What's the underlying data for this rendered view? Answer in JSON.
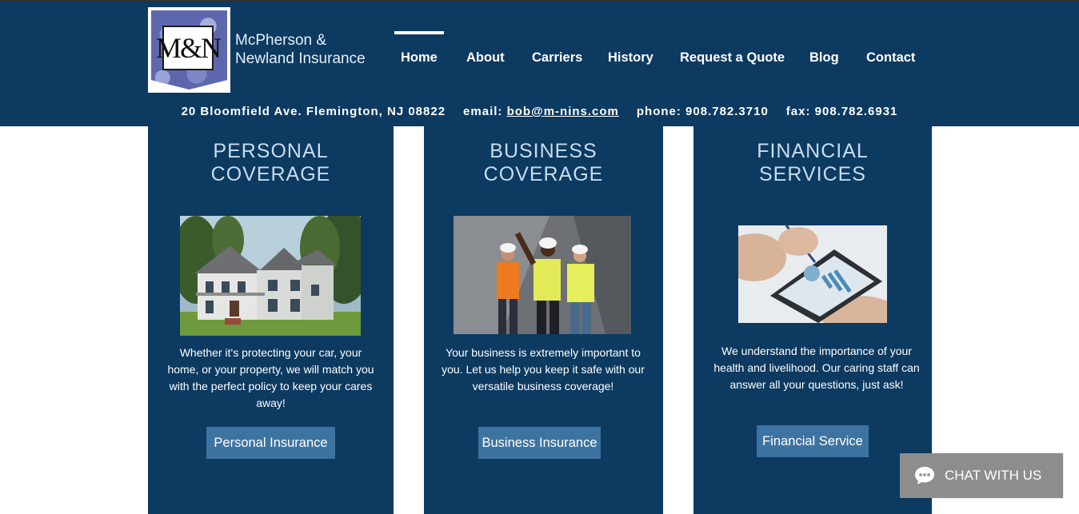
{
  "brand": {
    "logo_text": "M&N",
    "name_line1": "McPherson &",
    "name_line2": "Newland Insurance"
  },
  "nav": {
    "items": [
      {
        "label": "Home",
        "active": true
      },
      {
        "label": "About"
      },
      {
        "label": "Carriers"
      },
      {
        "label": "History"
      },
      {
        "label": "Request a Quote"
      },
      {
        "label": "Blog"
      },
      {
        "label": "Contact"
      }
    ]
  },
  "contact": {
    "address": "20 Bloomfield Ave. Flemington, NJ 08822",
    "email_label": "email:",
    "email": "bob@m-nins.com",
    "phone": "phone: 908.782.3710",
    "fax": "fax: 908.782.6931"
  },
  "cards": [
    {
      "title_line1": "PERSONAL",
      "title_line2": "COVERAGE",
      "text": "Whether it's protecting your car, your home, or your property, we will match you with the perfect policy to keep your cares away!",
      "button": "Personal Insurance",
      "icon": "house-photo"
    },
    {
      "title_line1": "BUSINESS",
      "title_line2": "COVERAGE",
      "text": "Your business is extremely important to you. Let us help you keep it safe with our versatile business coverage!",
      "button": "Business Insurance",
      "icon": "workers-photo"
    },
    {
      "title_line1": "FINANCIAL",
      "title_line2": "SERVICES",
      "text": "We understand the importance of your health and livelihood. Our caring staff can answer all your questions, just ask!",
      "button": "Financial Service",
      "icon": "tablet-chart-photo"
    }
  ],
  "chat": {
    "label": "CHAT WITH US",
    "icon": "chat-bubble-icon"
  },
  "colors": {
    "header_bg": "#0c3a61",
    "card_bg": "#0c3a61",
    "button_bg": "#3d73a0",
    "title_color": "#c7dcef",
    "chat_bg": "#8d8d8d"
  }
}
